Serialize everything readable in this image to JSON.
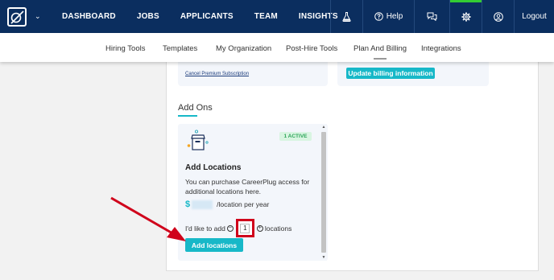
{
  "topbar": {
    "nav_links": [
      "DASHBOARD",
      "JOBS",
      "APPLICANTS",
      "TEAM",
      "INSIGHTS"
    ],
    "help_label": "Help",
    "logout_label": "Logout",
    "caret": "⌄",
    "icons": {
      "flask": "flask-icon",
      "help": "help-circle-icon",
      "chat": "chat-icon",
      "gear": "gear-icon",
      "user": "user-icon"
    },
    "accent_color": "#33cc33",
    "background": "#0b2e5f"
  },
  "subnav": {
    "items": [
      "Hiring Tools",
      "Templates",
      "My Organization",
      "Post-Hire Tools",
      "Plan And Billing",
      "Integrations"
    ],
    "active": "Plan And Billing"
  },
  "billing": {
    "cancel_link": "Cancel Premium Subscription",
    "update_button": "Update billing information"
  },
  "addons": {
    "title": "Add Ons",
    "card": {
      "badge": "1 ACTIVE",
      "heading": "Add Locations",
      "description": "You can purchase CareerPlug access for additional locations here.",
      "price_symbol": "$",
      "price_suffix": "/location per year",
      "qty_prefix": "I'd like to add",
      "qty_value": "1",
      "qty_suffix": "locations",
      "minus": "−",
      "plus": "+",
      "add_button": "Add locations"
    }
  },
  "colors": {
    "accent": "#17b8c8",
    "annotation": "#d0021b"
  }
}
